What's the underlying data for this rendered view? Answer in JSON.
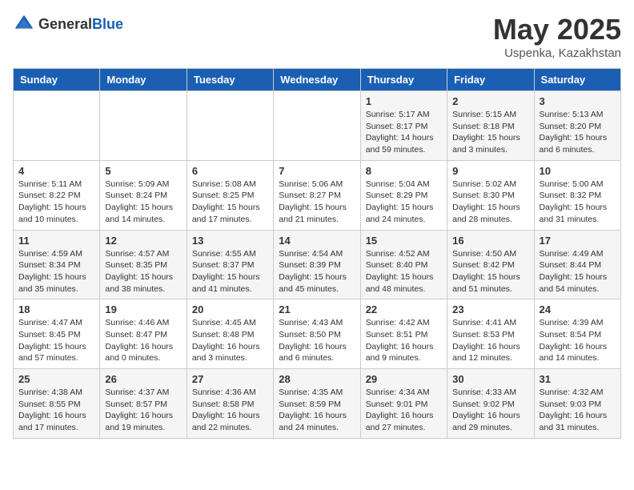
{
  "header": {
    "logo_general": "General",
    "logo_blue": "Blue",
    "title": "May 2025",
    "location": "Uspenka, Kazakhstan"
  },
  "days_of_week": [
    "Sunday",
    "Monday",
    "Tuesday",
    "Wednesday",
    "Thursday",
    "Friday",
    "Saturday"
  ],
  "weeks": [
    [
      {
        "day": "",
        "info": ""
      },
      {
        "day": "",
        "info": ""
      },
      {
        "day": "",
        "info": ""
      },
      {
        "day": "",
        "info": ""
      },
      {
        "day": "1",
        "info": "Sunrise: 5:17 AM\nSunset: 8:17 PM\nDaylight: 14 hours\nand 59 minutes."
      },
      {
        "day": "2",
        "info": "Sunrise: 5:15 AM\nSunset: 8:18 PM\nDaylight: 15 hours\nand 3 minutes."
      },
      {
        "day": "3",
        "info": "Sunrise: 5:13 AM\nSunset: 8:20 PM\nDaylight: 15 hours\nand 6 minutes."
      }
    ],
    [
      {
        "day": "4",
        "info": "Sunrise: 5:11 AM\nSunset: 8:22 PM\nDaylight: 15 hours\nand 10 minutes."
      },
      {
        "day": "5",
        "info": "Sunrise: 5:09 AM\nSunset: 8:24 PM\nDaylight: 15 hours\nand 14 minutes."
      },
      {
        "day": "6",
        "info": "Sunrise: 5:08 AM\nSunset: 8:25 PM\nDaylight: 15 hours\nand 17 minutes."
      },
      {
        "day": "7",
        "info": "Sunrise: 5:06 AM\nSunset: 8:27 PM\nDaylight: 15 hours\nand 21 minutes."
      },
      {
        "day": "8",
        "info": "Sunrise: 5:04 AM\nSunset: 8:29 PM\nDaylight: 15 hours\nand 24 minutes."
      },
      {
        "day": "9",
        "info": "Sunrise: 5:02 AM\nSunset: 8:30 PM\nDaylight: 15 hours\nand 28 minutes."
      },
      {
        "day": "10",
        "info": "Sunrise: 5:00 AM\nSunset: 8:32 PM\nDaylight: 15 hours\nand 31 minutes."
      }
    ],
    [
      {
        "day": "11",
        "info": "Sunrise: 4:59 AM\nSunset: 8:34 PM\nDaylight: 15 hours\nand 35 minutes."
      },
      {
        "day": "12",
        "info": "Sunrise: 4:57 AM\nSunset: 8:35 PM\nDaylight: 15 hours\nand 38 minutes."
      },
      {
        "day": "13",
        "info": "Sunrise: 4:55 AM\nSunset: 8:37 PM\nDaylight: 15 hours\nand 41 minutes."
      },
      {
        "day": "14",
        "info": "Sunrise: 4:54 AM\nSunset: 8:39 PM\nDaylight: 15 hours\nand 45 minutes."
      },
      {
        "day": "15",
        "info": "Sunrise: 4:52 AM\nSunset: 8:40 PM\nDaylight: 15 hours\nand 48 minutes."
      },
      {
        "day": "16",
        "info": "Sunrise: 4:50 AM\nSunset: 8:42 PM\nDaylight: 15 hours\nand 51 minutes."
      },
      {
        "day": "17",
        "info": "Sunrise: 4:49 AM\nSunset: 8:44 PM\nDaylight: 15 hours\nand 54 minutes."
      }
    ],
    [
      {
        "day": "18",
        "info": "Sunrise: 4:47 AM\nSunset: 8:45 PM\nDaylight: 15 hours\nand 57 minutes."
      },
      {
        "day": "19",
        "info": "Sunrise: 4:46 AM\nSunset: 8:47 PM\nDaylight: 16 hours\nand 0 minutes."
      },
      {
        "day": "20",
        "info": "Sunrise: 4:45 AM\nSunset: 8:48 PM\nDaylight: 16 hours\nand 3 minutes."
      },
      {
        "day": "21",
        "info": "Sunrise: 4:43 AM\nSunset: 8:50 PM\nDaylight: 16 hours\nand 6 minutes."
      },
      {
        "day": "22",
        "info": "Sunrise: 4:42 AM\nSunset: 8:51 PM\nDaylight: 16 hours\nand 9 minutes."
      },
      {
        "day": "23",
        "info": "Sunrise: 4:41 AM\nSunset: 8:53 PM\nDaylight: 16 hours\nand 12 minutes."
      },
      {
        "day": "24",
        "info": "Sunrise: 4:39 AM\nSunset: 8:54 PM\nDaylight: 16 hours\nand 14 minutes."
      }
    ],
    [
      {
        "day": "25",
        "info": "Sunrise: 4:38 AM\nSunset: 8:55 PM\nDaylight: 16 hours\nand 17 minutes."
      },
      {
        "day": "26",
        "info": "Sunrise: 4:37 AM\nSunset: 8:57 PM\nDaylight: 16 hours\nand 19 minutes."
      },
      {
        "day": "27",
        "info": "Sunrise: 4:36 AM\nSunset: 8:58 PM\nDaylight: 16 hours\nand 22 minutes."
      },
      {
        "day": "28",
        "info": "Sunrise: 4:35 AM\nSunset: 8:59 PM\nDaylight: 16 hours\nand 24 minutes."
      },
      {
        "day": "29",
        "info": "Sunrise: 4:34 AM\nSunset: 9:01 PM\nDaylight: 16 hours\nand 27 minutes."
      },
      {
        "day": "30",
        "info": "Sunrise: 4:33 AM\nSunset: 9:02 PM\nDaylight: 16 hours\nand 29 minutes."
      },
      {
        "day": "31",
        "info": "Sunrise: 4:32 AM\nSunset: 9:03 PM\nDaylight: 16 hours\nand 31 minutes."
      }
    ]
  ]
}
